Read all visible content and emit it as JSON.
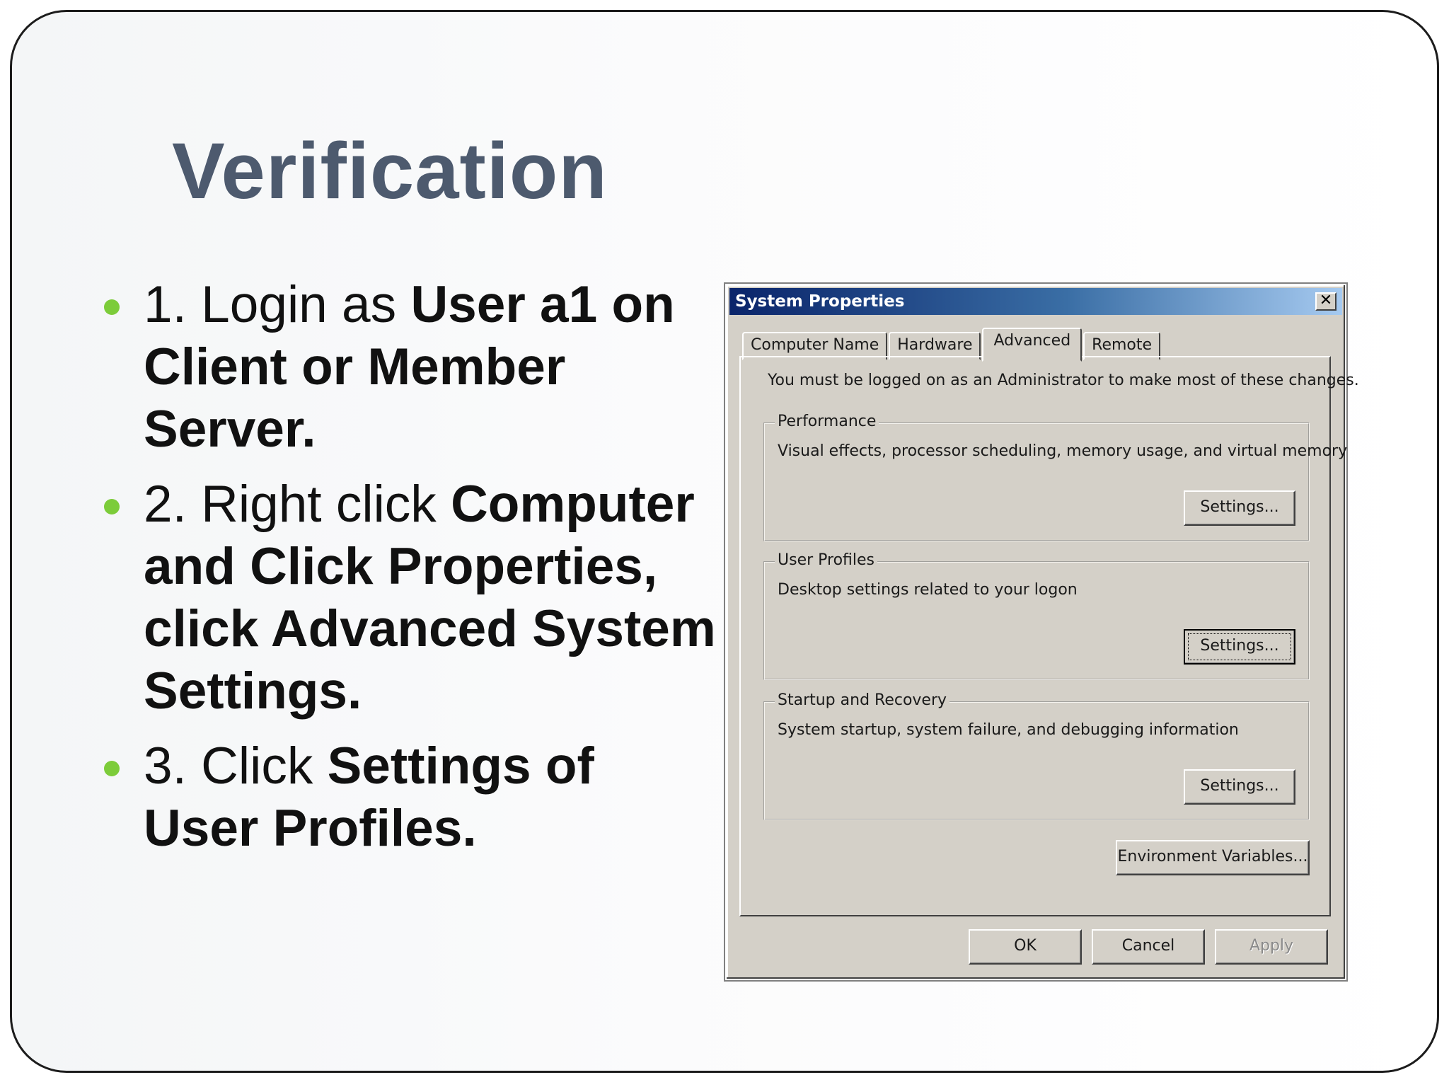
{
  "slide": {
    "title": "Verification",
    "bullets": [
      {
        "normal": "1. Login as ",
        "bold": "User a1 on Client or Member Server.",
        "normal_after": "",
        "bold_after": ""
      },
      {
        "normal": "2. Right click ",
        "bold": "Computer and Click Properties, click Advanced System Settings.",
        "normal_after": "",
        "bold_after": ""
      },
      {
        "normal": "3. Click ",
        "bold": "Settings of User Profiles.",
        "normal_after": "",
        "bold_after": ""
      }
    ],
    "accent_color": "#7ccc3a",
    "title_color": "#4d5a6e"
  },
  "dialog": {
    "title": "System Properties",
    "close_glyph": "✕",
    "tabs": [
      "Computer Name",
      "Hardware",
      "Advanced",
      "Remote"
    ],
    "active_tab": "Advanced",
    "notice": "You must be logged on as an Administrator to make most of these changes.",
    "groups": [
      {
        "legend": "Performance",
        "description": "Visual effects, processor scheduling, memory usage, and virtual memory",
        "button": "Settings..."
      },
      {
        "legend": "User Profiles",
        "description": "Desktop settings related to your logon",
        "button": "Settings..."
      },
      {
        "legend": "Startup and Recovery",
        "description": "System startup, system failure, and debugging information",
        "button": "Settings..."
      }
    ],
    "env_button": "Environment Variables...",
    "ok_button": "OK",
    "cancel_button": "Cancel",
    "apply_button": "Apply"
  }
}
